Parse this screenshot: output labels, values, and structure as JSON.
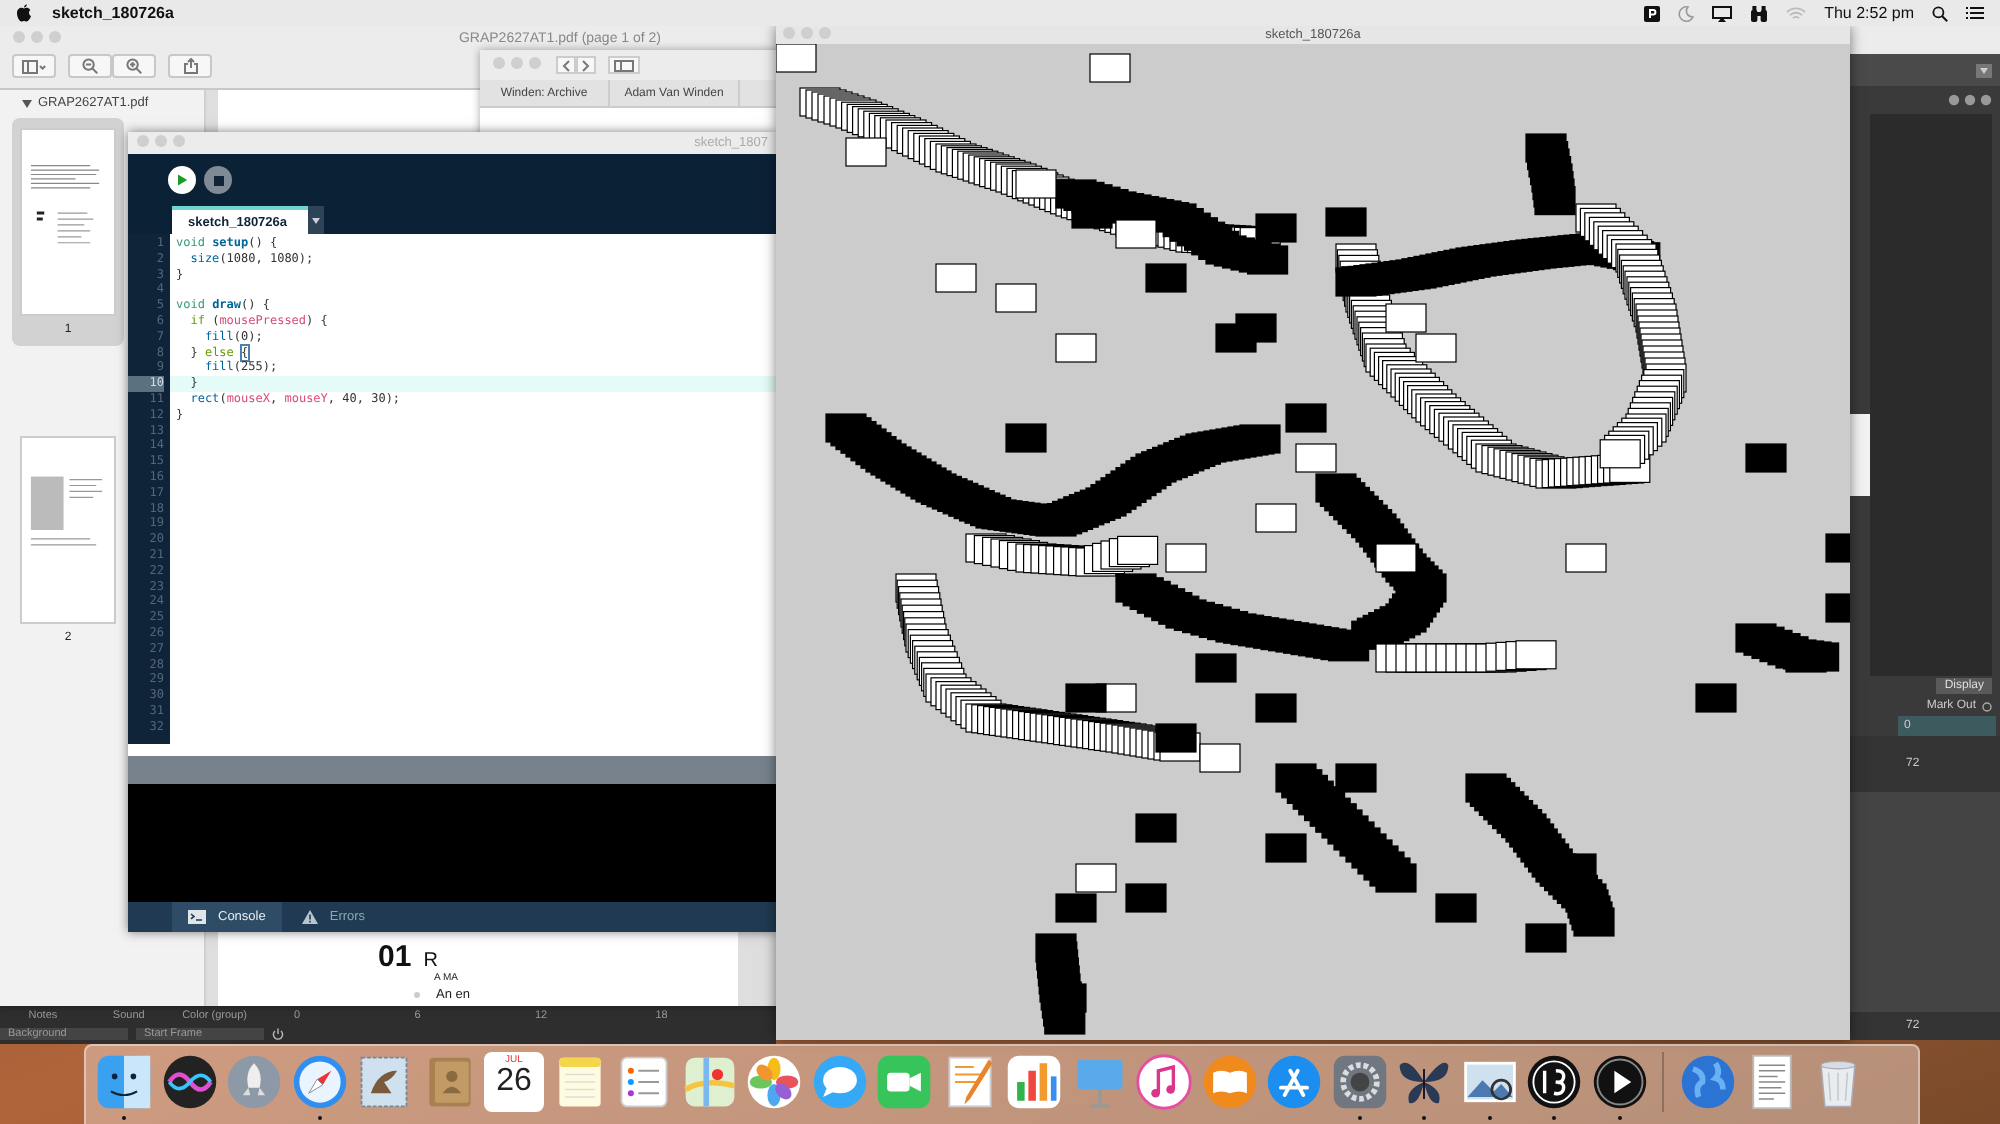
{
  "menu_bar": {
    "app_name": "sketch_180726a",
    "clock": "Thu 2:52 pm"
  },
  "preview_window": {
    "title": "GRAP2627AT1.pdf (page 1 of 2)",
    "sidebar_file": "GRAP2627AT1.pdf",
    "pages": [
      {
        "label": "1",
        "selected": true
      },
      {
        "label": "2",
        "selected": false
      }
    ],
    "page_heading": "01",
    "page_heading_2": "R",
    "page_subheading": "A MA",
    "page_body": "An en"
  },
  "finder_window": {
    "tabs": [
      {
        "label": "Winden: Archive"
      },
      {
        "label": "Adam Van Winden"
      }
    ]
  },
  "editor": {
    "title": "sketch_1807",
    "tab": "sketch_180726a",
    "line_numbers": [
      "1",
      "2",
      "3",
      "4",
      "5",
      "6",
      "7",
      "8",
      "9",
      "10",
      "11",
      "12",
      "13",
      "14",
      "15",
      "16",
      "17",
      "18",
      "19",
      "20",
      "21",
      "22",
      "23",
      "24",
      "25",
      "26",
      "27",
      "28",
      "29",
      "30",
      "31",
      "32"
    ],
    "lines": [
      {
        "current": false,
        "tokens": [
          {
            "kind": "type",
            "text": "void "
          },
          {
            "kind": "function",
            "text": "setup"
          },
          {
            "kind": "plain",
            "text": "() {"
          }
        ]
      },
      {
        "current": false,
        "tokens": [
          {
            "kind": "builtin",
            "text": "  size"
          },
          {
            "kind": "plain",
            "text": "(1080, 1080);"
          }
        ]
      },
      {
        "current": false,
        "tokens": [
          {
            "kind": "plain",
            "text": "}"
          }
        ]
      },
      {
        "current": false
      },
      {
        "current": false,
        "tokens": [
          {
            "kind": "type",
            "text": "void "
          },
          {
            "kind": "function",
            "text": "draw"
          },
          {
            "kind": "plain",
            "text": "() {"
          }
        ]
      },
      {
        "current": false,
        "tokens": [
          {
            "kind": "keyword",
            "text": "  if"
          },
          {
            "kind": "plain",
            "text": " ("
          },
          {
            "kind": "variable",
            "text": "mousePressed"
          },
          {
            "kind": "plain",
            "text": ") {"
          }
        ]
      },
      {
        "current": false,
        "tokens": [
          {
            "kind": "builtin",
            "text": "    fill"
          },
          {
            "kind": "plain",
            "text": "(0);"
          }
        ]
      },
      {
        "current": false,
        "tokens": [
          {
            "kind": "plain",
            "text": "  } "
          },
          {
            "kind": "keyword",
            "text": "else "
          },
          {
            "kind": "bracket_match",
            "text": "{"
          }
        ]
      },
      {
        "current": false,
        "tokens": [
          {
            "kind": "builtin",
            "text": "    fill"
          },
          {
            "kind": "plain",
            "text": "(255);"
          }
        ]
      },
      {
        "current": true,
        "tokens": [
          {
            "kind": "plain",
            "text": "  }"
          }
        ]
      },
      {
        "current": false,
        "tokens": [
          {
            "kind": "builtin",
            "text": "  rect"
          },
          {
            "kind": "plain",
            "text": "("
          },
          {
            "kind": "variable",
            "text": "mouseX"
          },
          {
            "kind": "plain",
            "text": ", "
          },
          {
            "kind": "variable",
            "text": "mouseY"
          },
          {
            "kind": "plain",
            "text": ", 40, 30);"
          }
        ]
      },
      {
        "current": false,
        "tokens": [
          {
            "kind": "plain",
            "text": "}"
          }
        ]
      }
    ],
    "console_tabs": [
      {
        "label": "Console",
        "selected": true
      },
      {
        "label": "Errors",
        "selected": false
      }
    ]
  },
  "sketch_window": {
    "title": "sketch_180726a"
  },
  "side_panel": {
    "display_label": "Display",
    "mark_out_label": "Mark Out",
    "mark_out_value": "0",
    "ruler_values": [
      "72",
      "72"
    ]
  },
  "timeline": {
    "layers": [
      "Notes",
      "Sound",
      "Color (group)"
    ],
    "frame_ticks": [
      "0",
      "6",
      "12",
      "18"
    ],
    "fields": [
      "Background",
      "Start Frame"
    ]
  },
  "dock": {
    "items": [
      {
        "running": true
      },
      {
        "running": false
      },
      {
        "running": false
      },
      {
        "running": true
      },
      {
        "running": false
      },
      {
        "running": false
      },
      {
        "running": false,
        "month": "JUL",
        "day": "26"
      },
      {
        "running": false
      },
      {
        "running": false
      },
      {
        "running": false
      },
      {
        "running": false
      },
      {
        "running": false
      },
      {
        "running": false
      },
      {
        "running": false
      },
      {
        "running": false
      },
      {
        "running": false
      },
      {
        "running": false
      },
      {
        "running": false
      },
      {
        "running": false
      },
      {
        "running": true
      },
      {
        "running": true
      },
      {
        "running": true
      },
      {
        "running": true
      },
      {
        "running": true
      },
      {
        "running": false
      },
      {
        "running": false
      },
      {
        "running": false
      }
    ]
  }
}
